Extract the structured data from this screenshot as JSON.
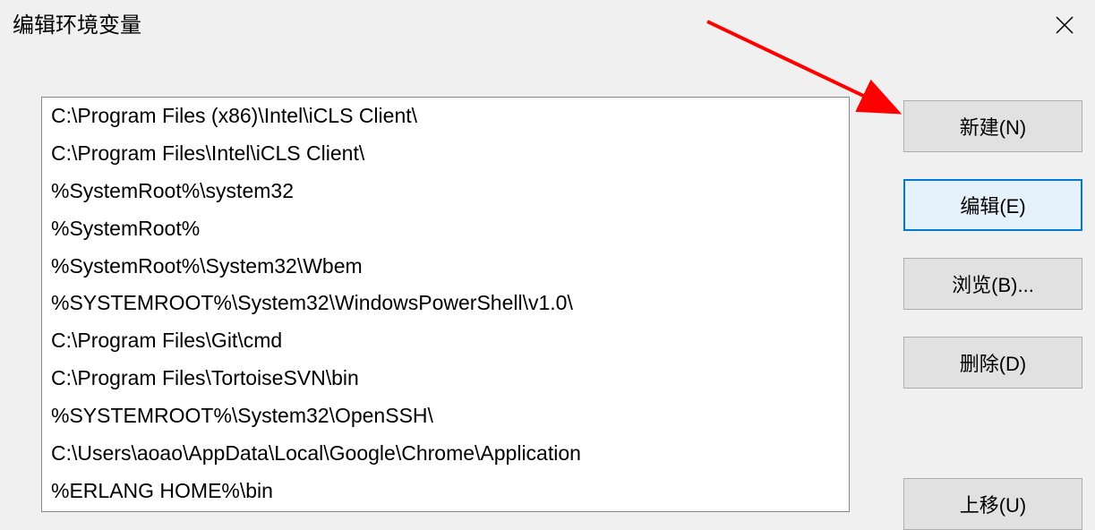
{
  "title": "编辑环境变量",
  "paths": [
    "C:\\Program Files (x86)\\Intel\\iCLS Client\\",
    "C:\\Program Files\\Intel\\iCLS Client\\",
    "%SystemRoot%\\system32",
    "%SystemRoot%",
    "%SystemRoot%\\System32\\Wbem",
    "%SYSTEMROOT%\\System32\\WindowsPowerShell\\v1.0\\",
    "C:\\Program Files\\Git\\cmd",
    "C:\\Program Files\\TortoiseSVN\\bin",
    "%SYSTEMROOT%\\System32\\OpenSSH\\",
    "C:\\Users\\aoao\\AppData\\Local\\Google\\Chrome\\Application",
    "%ERLANG HOME%\\bin"
  ],
  "buttons": {
    "new": "新建(N)",
    "edit": "编辑(E)",
    "browse": "浏览(B)...",
    "delete": "删除(D)",
    "move_up": "上移(U)"
  },
  "annotation": {
    "arrow_color": "#ff0000",
    "points_to": "new-button"
  }
}
